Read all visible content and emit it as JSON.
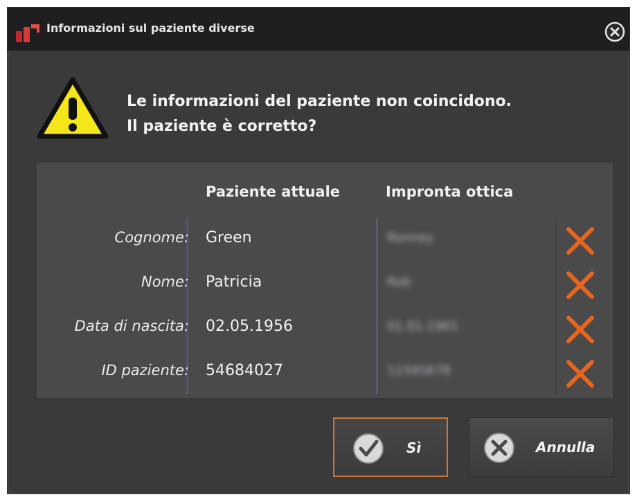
{
  "window": {
    "title": "Informazioni sul paziente diverse"
  },
  "message": {
    "line1": "Le informazioni del paziente non coincidono.",
    "line2": "Il paziente è corretto?"
  },
  "table": {
    "headers": {
      "current": "Paziente attuale",
      "optical": "Impronta ottica"
    },
    "rows": [
      {
        "label": "Cognome:",
        "current": "Green",
        "optical": "Ronney"
      },
      {
        "label": "Nome:",
        "current": "Patricia",
        "optical": "Rob"
      },
      {
        "label": "Data di nascita:",
        "current": "02.05.1956",
        "optical": "01.01.1961"
      },
      {
        "label": "ID paziente:",
        "current": "54684027",
        "optical": "12345678"
      }
    ]
  },
  "buttons": {
    "yes": "Sì",
    "cancel": "Annulla"
  },
  "colors": {
    "accent": "#e8651e",
    "warning": "#f5e61a",
    "focus_border": "#c8783a"
  },
  "icons": {
    "app": "app-logo-icon",
    "close": "close-circle-icon",
    "warning": "warning-triangle-icon",
    "mismatch": "x-mark-icon",
    "yes": "check-circle-icon",
    "cancel": "x-circle-icon"
  }
}
